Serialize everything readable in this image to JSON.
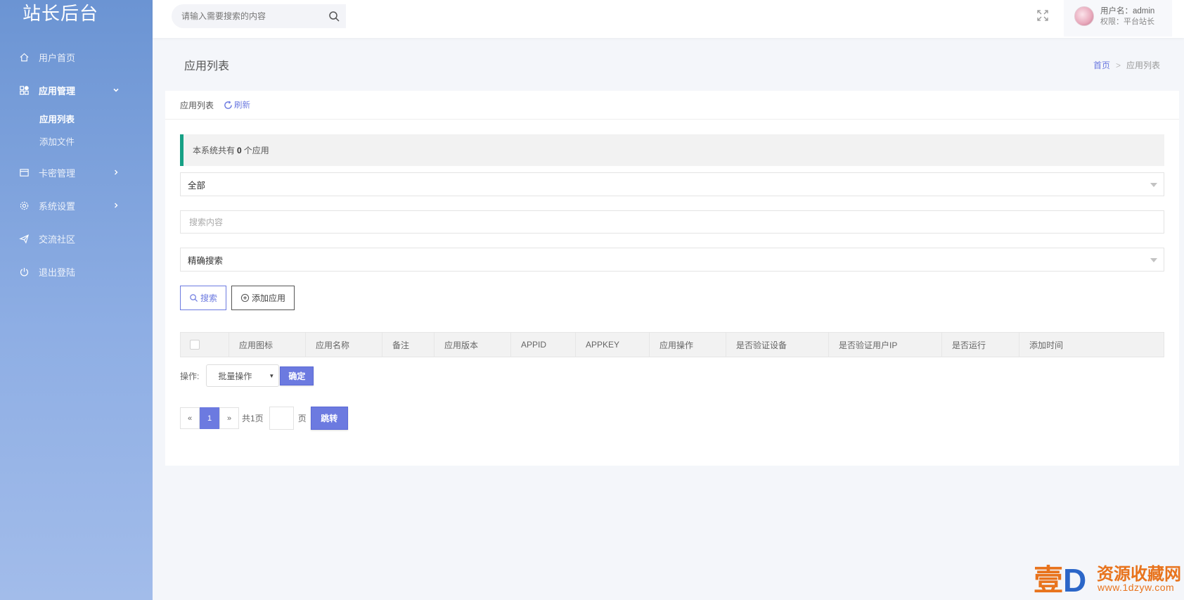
{
  "app": {
    "brand": "站长后台"
  },
  "sidebar": {
    "items": [
      {
        "label": "用户首页",
        "icon": "home-icon"
      },
      {
        "label": "应用管理",
        "icon": "apps-icon",
        "expanded": true,
        "children": [
          {
            "label": "应用列表",
            "active": true
          },
          {
            "label": "添加文件"
          }
        ]
      },
      {
        "label": "卡密管理",
        "icon": "card-icon"
      },
      {
        "label": "系统设置",
        "icon": "gear-icon"
      },
      {
        "label": "交流社区",
        "icon": "send-icon"
      },
      {
        "label": "退出登陆",
        "icon": "power-icon"
      }
    ]
  },
  "header": {
    "search_placeholder": "请输入需要搜索的内容",
    "user_name": "用户名：admin",
    "user_role": "权限：平台站长"
  },
  "page": {
    "title": "应用列表",
    "breadcrumb": {
      "home": "首页",
      "sep": ">",
      "current": "应用列表"
    }
  },
  "card": {
    "title": "应用列表",
    "refresh": "刷新",
    "notice_prefix": "本系统共有",
    "notice_count": "0",
    "notice_suffix": "个应用",
    "filter_select": "全部",
    "search_placeholder": "搜索内容",
    "mode_select": "精确搜索",
    "search_button": "搜索",
    "add_button": "添加应用",
    "table_headers": [
      "应用图标",
      "应用名称",
      "备注",
      "应用版本",
      "APPID",
      "APPKEY",
      "应用操作",
      "是否验证设备",
      "是否验证用户IP",
      "是否运行",
      "添加时间"
    ],
    "ops_label": "操作:",
    "batch_select": "批量操作",
    "confirm_button": "确定",
    "pager": {
      "prev": "«",
      "current": "1",
      "next": "»",
      "total": "共1页",
      "unit": "页",
      "go": "跳转"
    }
  },
  "watermark": {
    "char": "壹",
    "letter": "D",
    "line1": "资源收藏网",
    "line2": "www.1dzyw.com"
  },
  "colors": {
    "accent": "#6c7ae0",
    "notice_border": "#16a085",
    "sidebar_top": "#6b94d3",
    "sidebar_bottom": "#a2bcea",
    "watermark": "#e8731c"
  }
}
